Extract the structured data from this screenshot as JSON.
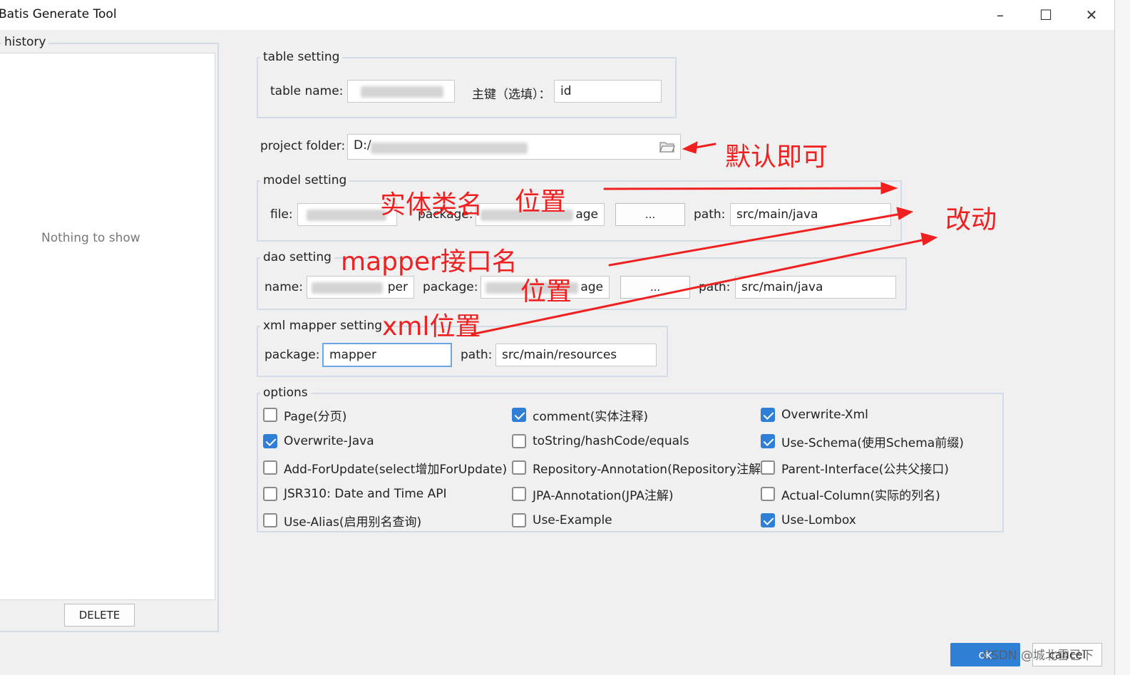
{
  "window": {
    "title": "Batis Generate Tool",
    "minimize": "–",
    "maximize": "☐",
    "close": "✕"
  },
  "history": {
    "legend": "history",
    "empty_text": "Nothing to show",
    "delete_label": "DELETE"
  },
  "table_setting": {
    "legend": "table setting",
    "table_name_label": "table  name:",
    "pk_label": "主键（选填）：",
    "pk_value": "id"
  },
  "project": {
    "label": "project folder:",
    "value": "D:/"
  },
  "model_setting": {
    "legend": "model setting",
    "file_label": "file:",
    "package_label": "package:",
    "package_suffix": "age",
    "browse_label": "...",
    "path_label": "path:",
    "path_value": "src/main/java"
  },
  "dao_setting": {
    "legend": "dao setting",
    "name_label": "name:",
    "name_suffix": "per",
    "package_label": "package:",
    "package_suffix": "age",
    "browse_label": "...",
    "path_label": "path:",
    "path_value": "src/main/java"
  },
  "xml_setting": {
    "legend": "xml mapper setting",
    "package_label": "package:",
    "package_value": "mapper",
    "path_label": "path:",
    "path_value": "src/main/resources"
  },
  "options": {
    "legend": "options",
    "items": [
      {
        "label": "Page(分页)",
        "checked": false
      },
      {
        "label": "comment(实体注释)",
        "checked": true
      },
      {
        "label": "Overwrite-Xml",
        "checked": true
      },
      {
        "label": "Overwrite-Java",
        "checked": true
      },
      {
        "label": "toString/hashCode/equals",
        "checked": false
      },
      {
        "label": "Use-Schema(使用Schema前缀)",
        "checked": true
      },
      {
        "label": "Add-ForUpdate(select增加ForUpdate)",
        "checked": false
      },
      {
        "label": "Repository-Annotation(Repository注解)",
        "checked": false
      },
      {
        "label": "Parent-Interface(公共父接口)",
        "checked": false
      },
      {
        "label": "JSR310: Date and Time API",
        "checked": false
      },
      {
        "label": "JPA-Annotation(JPA注解)",
        "checked": false
      },
      {
        "label": "Actual-Column(实际的列名)",
        "checked": false
      },
      {
        "label": "Use-Alias(启用别名查询)",
        "checked": false
      },
      {
        "label": "Use-Example",
        "checked": false
      },
      {
        "label": "Use-Lombox",
        "checked": true
      }
    ]
  },
  "annotations": {
    "default_ok": "默认即可",
    "entity_name": "实体类名",
    "position1": "位置",
    "change": "改动",
    "mapper_name": "mapper接口名",
    "position2": "位置",
    "xml_position": "xml位置",
    "color": "#f02020"
  },
  "footer": {
    "ok_label": "ok",
    "cancel_label": "cancel",
    "watermark": "CSDN @城北雪已下"
  }
}
